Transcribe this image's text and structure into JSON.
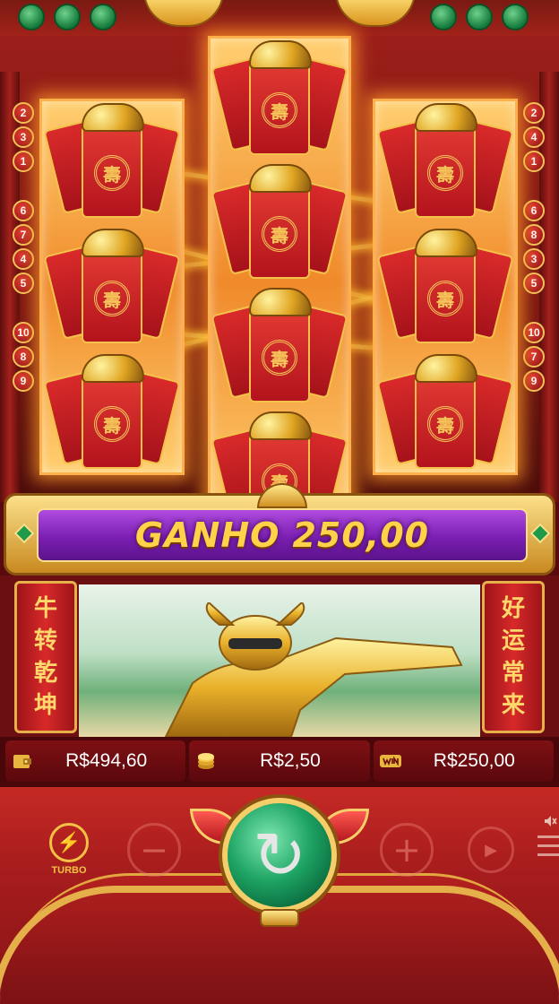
{
  "slot": {
    "left_lines": [
      [
        "2",
        "3",
        "1"
      ],
      [
        "6",
        "7",
        "4",
        "5"
      ],
      [
        "10",
        "8",
        "9"
      ]
    ],
    "right_lines": [
      [
        "2",
        "4",
        "1"
      ],
      [
        "6",
        "8",
        "3",
        "5"
      ],
      [
        "10",
        "7",
        "9"
      ]
    ],
    "reels": [
      {
        "symbol": "red-envelope",
        "count": 3
      },
      {
        "symbol": "red-envelope",
        "count": 4
      },
      {
        "symbol": "red-envelope",
        "count": 3
      }
    ],
    "emblem_glyph": "壽"
  },
  "win_banner": {
    "label": "GANHO",
    "amount": "250,00"
  },
  "scene": {
    "left_couplet": [
      "牛",
      "转",
      "乾",
      "坤"
    ],
    "right_couplet": [
      "好",
      "运",
      "常",
      "来"
    ]
  },
  "stats": {
    "balance": "R$494,60",
    "bet": "R$2,50",
    "win": "R$250,00"
  },
  "controls": {
    "turbo_label": "TURBO",
    "turbo_icon": "lightning-icon",
    "minus_glyph": "−",
    "plus_glyph": "+",
    "spin_glyph": "↻",
    "auto_glyph": "▶",
    "mute_glyph": "🔇"
  },
  "colors": {
    "accent_gold": "#f2c245",
    "banner_purple": "#7a1fb2",
    "spin_green": "#1ea464",
    "bg_red": "#a91d1d"
  }
}
